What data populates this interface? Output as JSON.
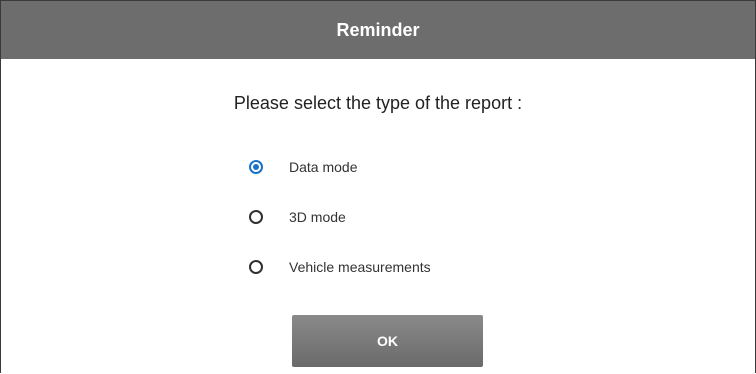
{
  "dialog": {
    "title": "Reminder",
    "prompt": "Please select the type of the report :",
    "options": [
      {
        "label": "Data mode",
        "selected": true
      },
      {
        "label": "3D mode",
        "selected": false
      },
      {
        "label": "Vehicle measurements",
        "selected": false
      }
    ],
    "ok_label": "OK"
  },
  "colors": {
    "title_bar": "#6d6d6d",
    "accent": "#1a73c9",
    "button": "#7a7a7a"
  }
}
